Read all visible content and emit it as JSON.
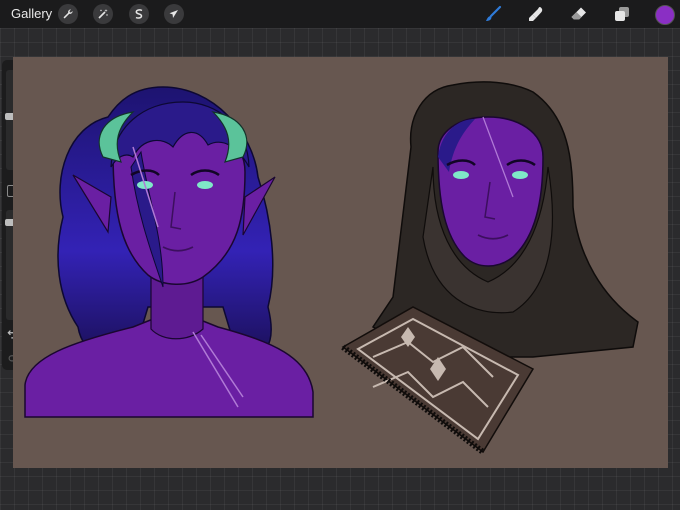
{
  "toolbar": {
    "gallery_label": "Gallery",
    "left_tools": [
      "wrench-icon",
      "magic-wand-icon",
      "selection-icon",
      "transform-arrow-icon"
    ],
    "right_tools": [
      "brush-icon",
      "smudge-icon",
      "eraser-icon",
      "layers-icon"
    ],
    "active_tool": "brush-icon",
    "current_color": "#8a2fc4",
    "active_tool_color": "#2f7bd8"
  },
  "sidebar": {
    "brush_size_level": 0.18,
    "opacity_level": 0.12
  },
  "canvas": {
    "background_color": "#675750",
    "skin_color": "#6a1fa3",
    "hair_color": "#2a1a8a",
    "hood_color": "#2c2724",
    "eye_color": "#7fe8c8"
  }
}
